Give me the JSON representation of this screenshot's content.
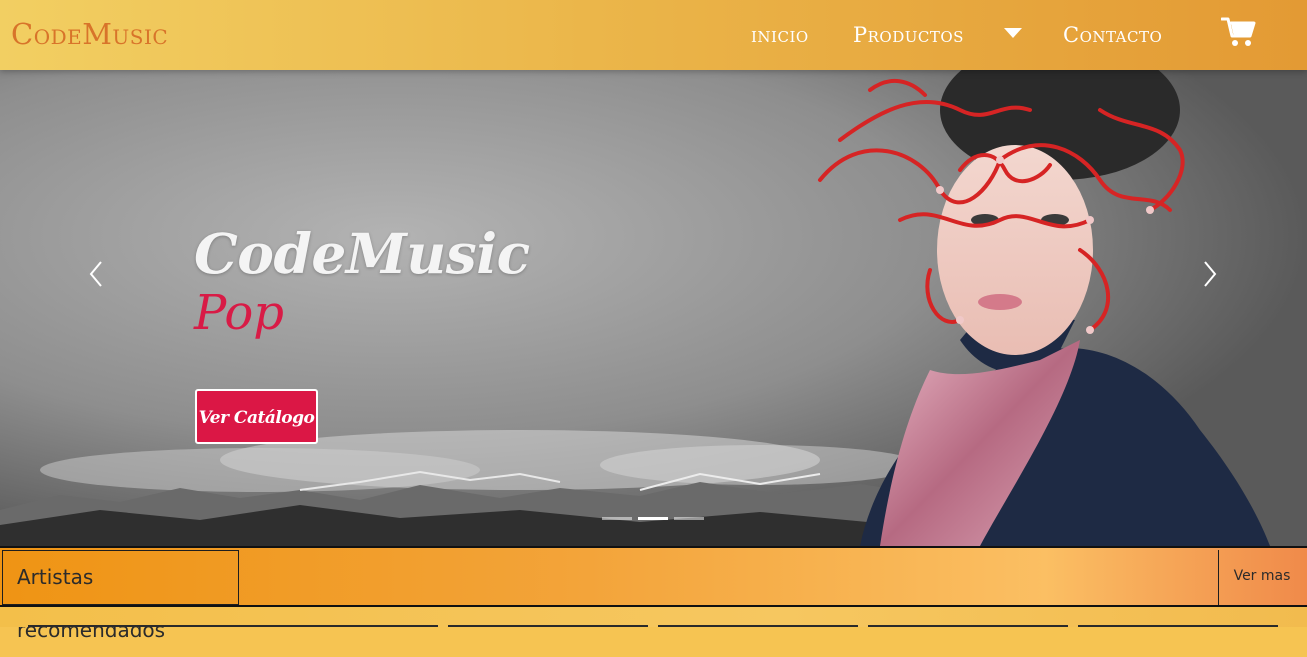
{
  "brand": {
    "name": "CodeMusic"
  },
  "nav": {
    "inicio": "inicio",
    "productos": "Productos",
    "contacto": "Contacto"
  },
  "icons": {
    "cart": "shopping-cart-icon",
    "dropdown": "caret-down-icon",
    "prev": "chevron-left-icon",
    "next": "chevron-right-icon"
  },
  "hero": {
    "title": "CodeMusic",
    "subtitle": "Pop",
    "button_label": "Ver Catálogo",
    "slides_total": 3,
    "active_slide": 2
  },
  "artists": {
    "label": "Artistas recomendados",
    "more": "Ver mas"
  },
  "colors": {
    "accent": "#db1745",
    "brand": "#d8742a",
    "nav_start": "#f2cf62",
    "nav_end": "#e39a34",
    "bar_orange": "#ef9414"
  }
}
